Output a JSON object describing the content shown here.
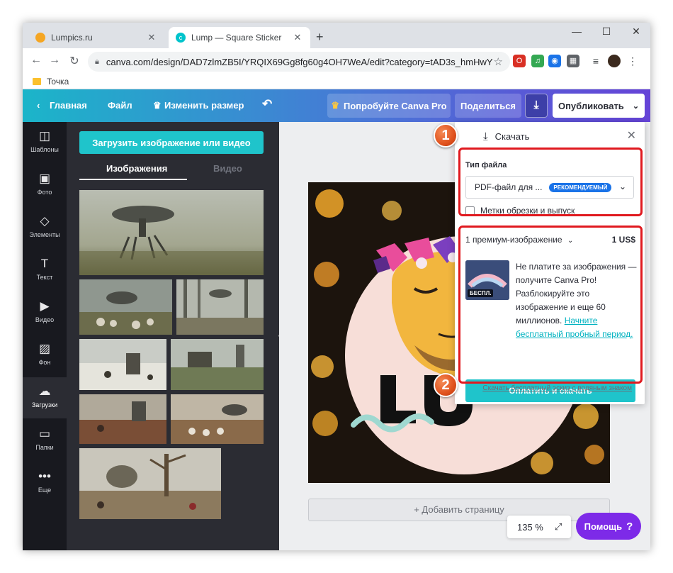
{
  "browser": {
    "tabs": [
      {
        "title": "Lumpics.ru",
        "favicon_color": "#f5a623"
      },
      {
        "title": "Lump — Square Sticker",
        "favicon_color": "#00c4cc"
      }
    ],
    "new_tab_label": "+",
    "window_controls": [
      "—",
      "☐",
      "✕"
    ],
    "url": "canva.com/design/DAD7zlmZB5I/YRQIX69Gg8fg60g4OH7WeA/edit?category=tAD3s_hmHwY",
    "bookmark": "Точка"
  },
  "header": {
    "home": "Главная",
    "file": "Файл",
    "resize": "Изменить размер",
    "undo_icon": "↶",
    "try_pro": "Попробуйте Canva Pro",
    "share": "Поделиться",
    "download_icon": "⤓",
    "publish": "Опубликовать"
  },
  "sidebar": {
    "items": [
      {
        "label": "Шаблоны",
        "icon": "◫"
      },
      {
        "label": "Фото",
        "icon": "▣"
      },
      {
        "label": "Элементы",
        "icon": "◇"
      },
      {
        "label": "Текст",
        "icon": "T"
      },
      {
        "label": "Видео",
        "icon": "▶"
      },
      {
        "label": "Фон",
        "icon": "▨"
      },
      {
        "label": "Загрузки",
        "icon": "☁"
      },
      {
        "label": "Папки",
        "icon": "▭"
      },
      {
        "label": "Еще",
        "icon": "•••"
      }
    ],
    "active_index": 6
  },
  "uploads": {
    "upload_button": "Загрузить изображение или видео",
    "tab_images": "Изображения",
    "tab_video": "Видео"
  },
  "canvas": {
    "add_page": "+ Добавить страницу",
    "zoom": "135 %",
    "help": "Помощь",
    "help_icon": "?"
  },
  "download_panel": {
    "title": "Скачать",
    "file_type_label": "Тип файла",
    "file_type_value": "PDF-файл для ...",
    "recommended_badge": "РЕКОМЕНДУЕМЫЙ",
    "crop_marks": "Метки обрезки и выпуск",
    "premium_count": "1 премиум-изображение",
    "price": "1 US$",
    "free_badge": "БЕСПЛ.",
    "premium_text": "Не платите за изображения — получите Canva Pro! Разблокируйте это изображение и еще 60 миллионов.",
    "trial_link": "Начните бесплатный пробный период.",
    "pay_button": "Оплатить и скачать",
    "watermark_link": "Скачать бесплатный эскиз с водяным знаком"
  },
  "annotations": {
    "marker_1": "1",
    "marker_2": "2",
    "highlight_color": "#e0191f"
  }
}
